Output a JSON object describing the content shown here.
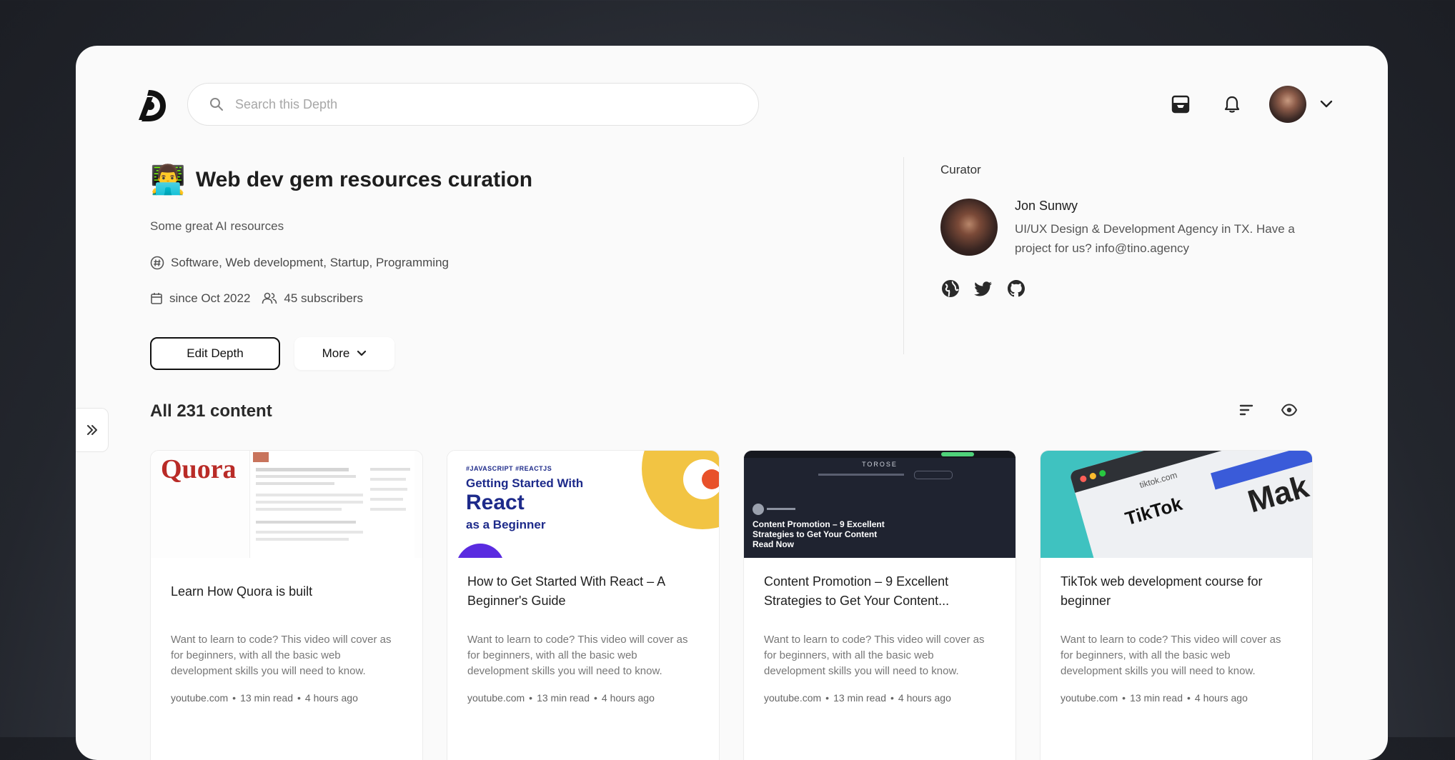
{
  "search": {
    "placeholder": "Search this Depth"
  },
  "depth": {
    "emoji": "👨‍💻",
    "title": "Web dev gem resources curation",
    "subtitle": "Some great AI resources",
    "tags": "Software, Web development, Startup, Programming",
    "since": "since Oct 2022",
    "subscribers": "45 subscribers",
    "edit_label": "Edit Depth",
    "more_label": "More"
  },
  "curator": {
    "label": "Curator",
    "name": "Jon Sunwy",
    "bio": "UI/UX Design & Development Agency in TX. Have a project for us? info@tino.agency"
  },
  "content": {
    "heading": "All 231 content",
    "cards": [
      {
        "title": "Learn How Quora is built",
        "desc": "Want to learn to code? This video will cover as for beginners, with all the basic web development skills you will need to know.",
        "source": "youtube.com",
        "read": "13 min read",
        "time": "4 hours ago",
        "thumb": {
          "brand": "Quora"
        }
      },
      {
        "title": "How to Get Started With React – A Beginner's Guide",
        "desc": "Want to learn to code? This video will cover as for beginners, with all the basic web development skills you will need to know.",
        "source": "youtube.com",
        "read": "13 min read",
        "time": "4 hours ago",
        "thumb": {
          "kicker": "#JAVASCRIPT #REACTJS",
          "line1": "Getting Started With",
          "line2": "React",
          "line3": "as a Beginner"
        }
      },
      {
        "title": "Content Promotion – 9 Excellent Strategies to Get Your Content...",
        "desc": "Want to learn to code? This video will cover as for beginners, with all the basic web development skills you will need to know.",
        "source": "youtube.com",
        "read": "13 min read",
        "time": "4 hours ago",
        "thumb": {
          "brand": "TOROSE",
          "line1": "Content Promotion – 9 Excellent",
          "line2": "Strategies to Get Your Content",
          "line3": "Read Now"
        }
      },
      {
        "title": "TikTok web development course for beginner",
        "desc": "Want to learn to code? This video will cover as for beginners, with all the basic web development skills you will need to know.",
        "source": "youtube.com",
        "read": "13 min read",
        "time": "4 hours ago",
        "thumb": {
          "url": "tiktok.com",
          "brand": "TikTok",
          "big": "Mak"
        }
      }
    ]
  },
  "colors": {
    "accent": "#111111",
    "react_blue": "#1d2a8a",
    "react_yellow": "#f2c443",
    "tiktok_teal": "#3fc2c0",
    "quora_red": "#b92b27"
  }
}
